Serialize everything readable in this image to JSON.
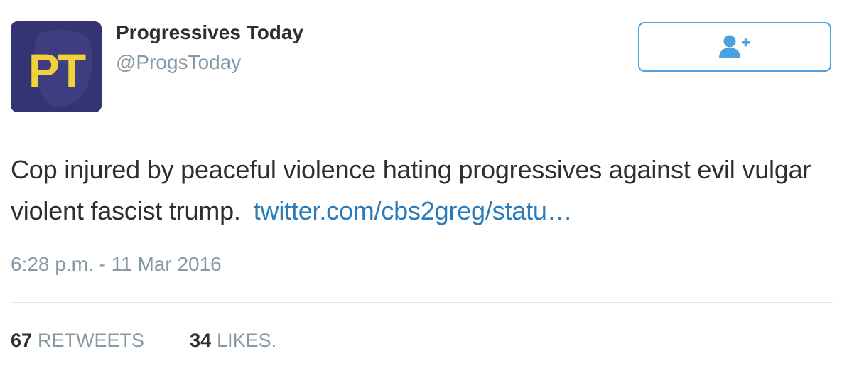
{
  "author": {
    "display_name": "Progressives Today",
    "handle": "@ProgsToday",
    "avatar_text": "PT"
  },
  "follow_button": {
    "icon": "follow-user-plus-icon"
  },
  "tweet": {
    "text": "Cop injured by peaceful violence hating progressives against evil vulgar violent fascist trump.",
    "link": "twitter.com/cbs2greg/statu…",
    "timestamp": "6:28 p.m. - 11 Mar 2016"
  },
  "stats": {
    "retweets_count": "67",
    "retweets_label": "RETWEETS",
    "likes_count": "34",
    "likes_label": "LIKES."
  },
  "colors": {
    "link": "#2b7bb9",
    "follow_border": "#4aa1de",
    "muted": "#8899a6",
    "text": "#292f33",
    "avatar_bg": "#343474",
    "avatar_letters": "#f2d23a"
  }
}
